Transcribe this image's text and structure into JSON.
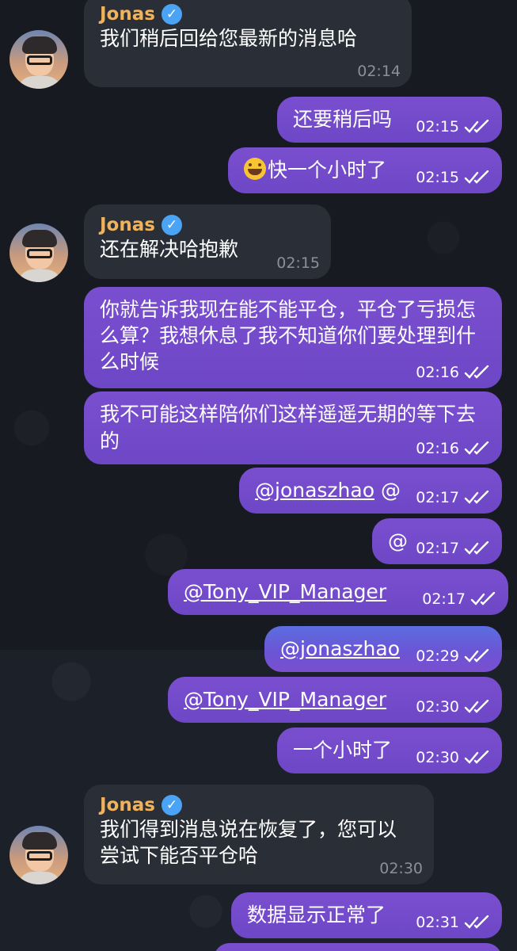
{
  "contact": {
    "name": "Jonas"
  },
  "messages": [
    {
      "side": "in",
      "text": "我们稍后回给您最新的消息哈",
      "time": "02:14"
    },
    {
      "side": "out",
      "text": "还要稍后吗",
      "time": "02:15"
    },
    {
      "side": "out",
      "emoji": "grinning-sweat-emoji",
      "text": "快一个小时了",
      "time": "02:15"
    },
    {
      "side": "in",
      "text": "还在解决哈抱歉",
      "time": "02:15"
    },
    {
      "side": "out",
      "text": "你就告诉我现在能不能平仓，平仓了亏损怎么算？我想休息了我不知道你们要处理到什么时候",
      "time": "02:16"
    },
    {
      "side": "out",
      "text": "我不可能这样陪你们这样遥遥无期的等下去的",
      "time": "02:16"
    },
    {
      "side": "out",
      "mention": "@jonaszhao",
      "text": "@",
      "time": "02:17"
    },
    {
      "side": "out",
      "text": "@",
      "time": "02:17"
    },
    {
      "side": "out",
      "mention": "@Tony_VIP_Manager",
      "time": "02:17"
    },
    {
      "side": "out",
      "mention": "@jonaszhao",
      "time": "02:29"
    },
    {
      "side": "out",
      "mention": "@Tony_VIP_Manager",
      "time": "02:30"
    },
    {
      "side": "out",
      "text": "一个小时了",
      "time": "02:30"
    },
    {
      "side": "in",
      "text": "我们得到消息说在恢复了，您可以尝试下能否平仓哈",
      "time": "02:30"
    },
    {
      "side": "out",
      "text": "数据显示正常了",
      "time": "02:31"
    }
  ],
  "icons": {
    "read": "double-check-icon",
    "verified": "verified-badge-icon"
  },
  "colors": {
    "sender": "#f0b25a",
    "outgoing": "#7a4fcf",
    "incoming": "#2a2f37",
    "background": "#1e232b"
  }
}
